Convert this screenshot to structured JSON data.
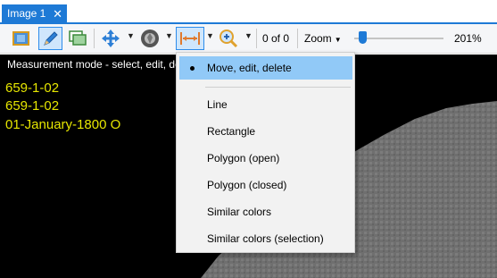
{
  "tab": {
    "title": "Image 1",
    "close_glyph": "✕"
  },
  "toolbar": {
    "icons": [
      "crop-icon",
      "pencil-icon",
      "windows-icon",
      "move-arrows-icon",
      "shutter-icon",
      "measure-icon",
      "zoom-in-icon"
    ],
    "counter": "0 of 0",
    "zoom_label": "Zoom",
    "zoom_value": "201%",
    "zoom_slider_fraction": 0.1
  },
  "canvas": {
    "status_text": "Measurement mode - select, edit, de",
    "overlay_lines": [
      "659-1-02",
      "659-1-02",
      "01-January-1800 O"
    ]
  },
  "menu": {
    "selected": "Move, edit, delete",
    "items": [
      "Line",
      "Rectangle",
      "Polygon (open)",
      "Polygon (closed)",
      "Similar colors",
      "Similar colors (selection)"
    ]
  },
  "colors": {
    "accent": "#1e7ad6",
    "menu_highlight": "#91c9f7",
    "overlay_text": "#e6e600"
  }
}
